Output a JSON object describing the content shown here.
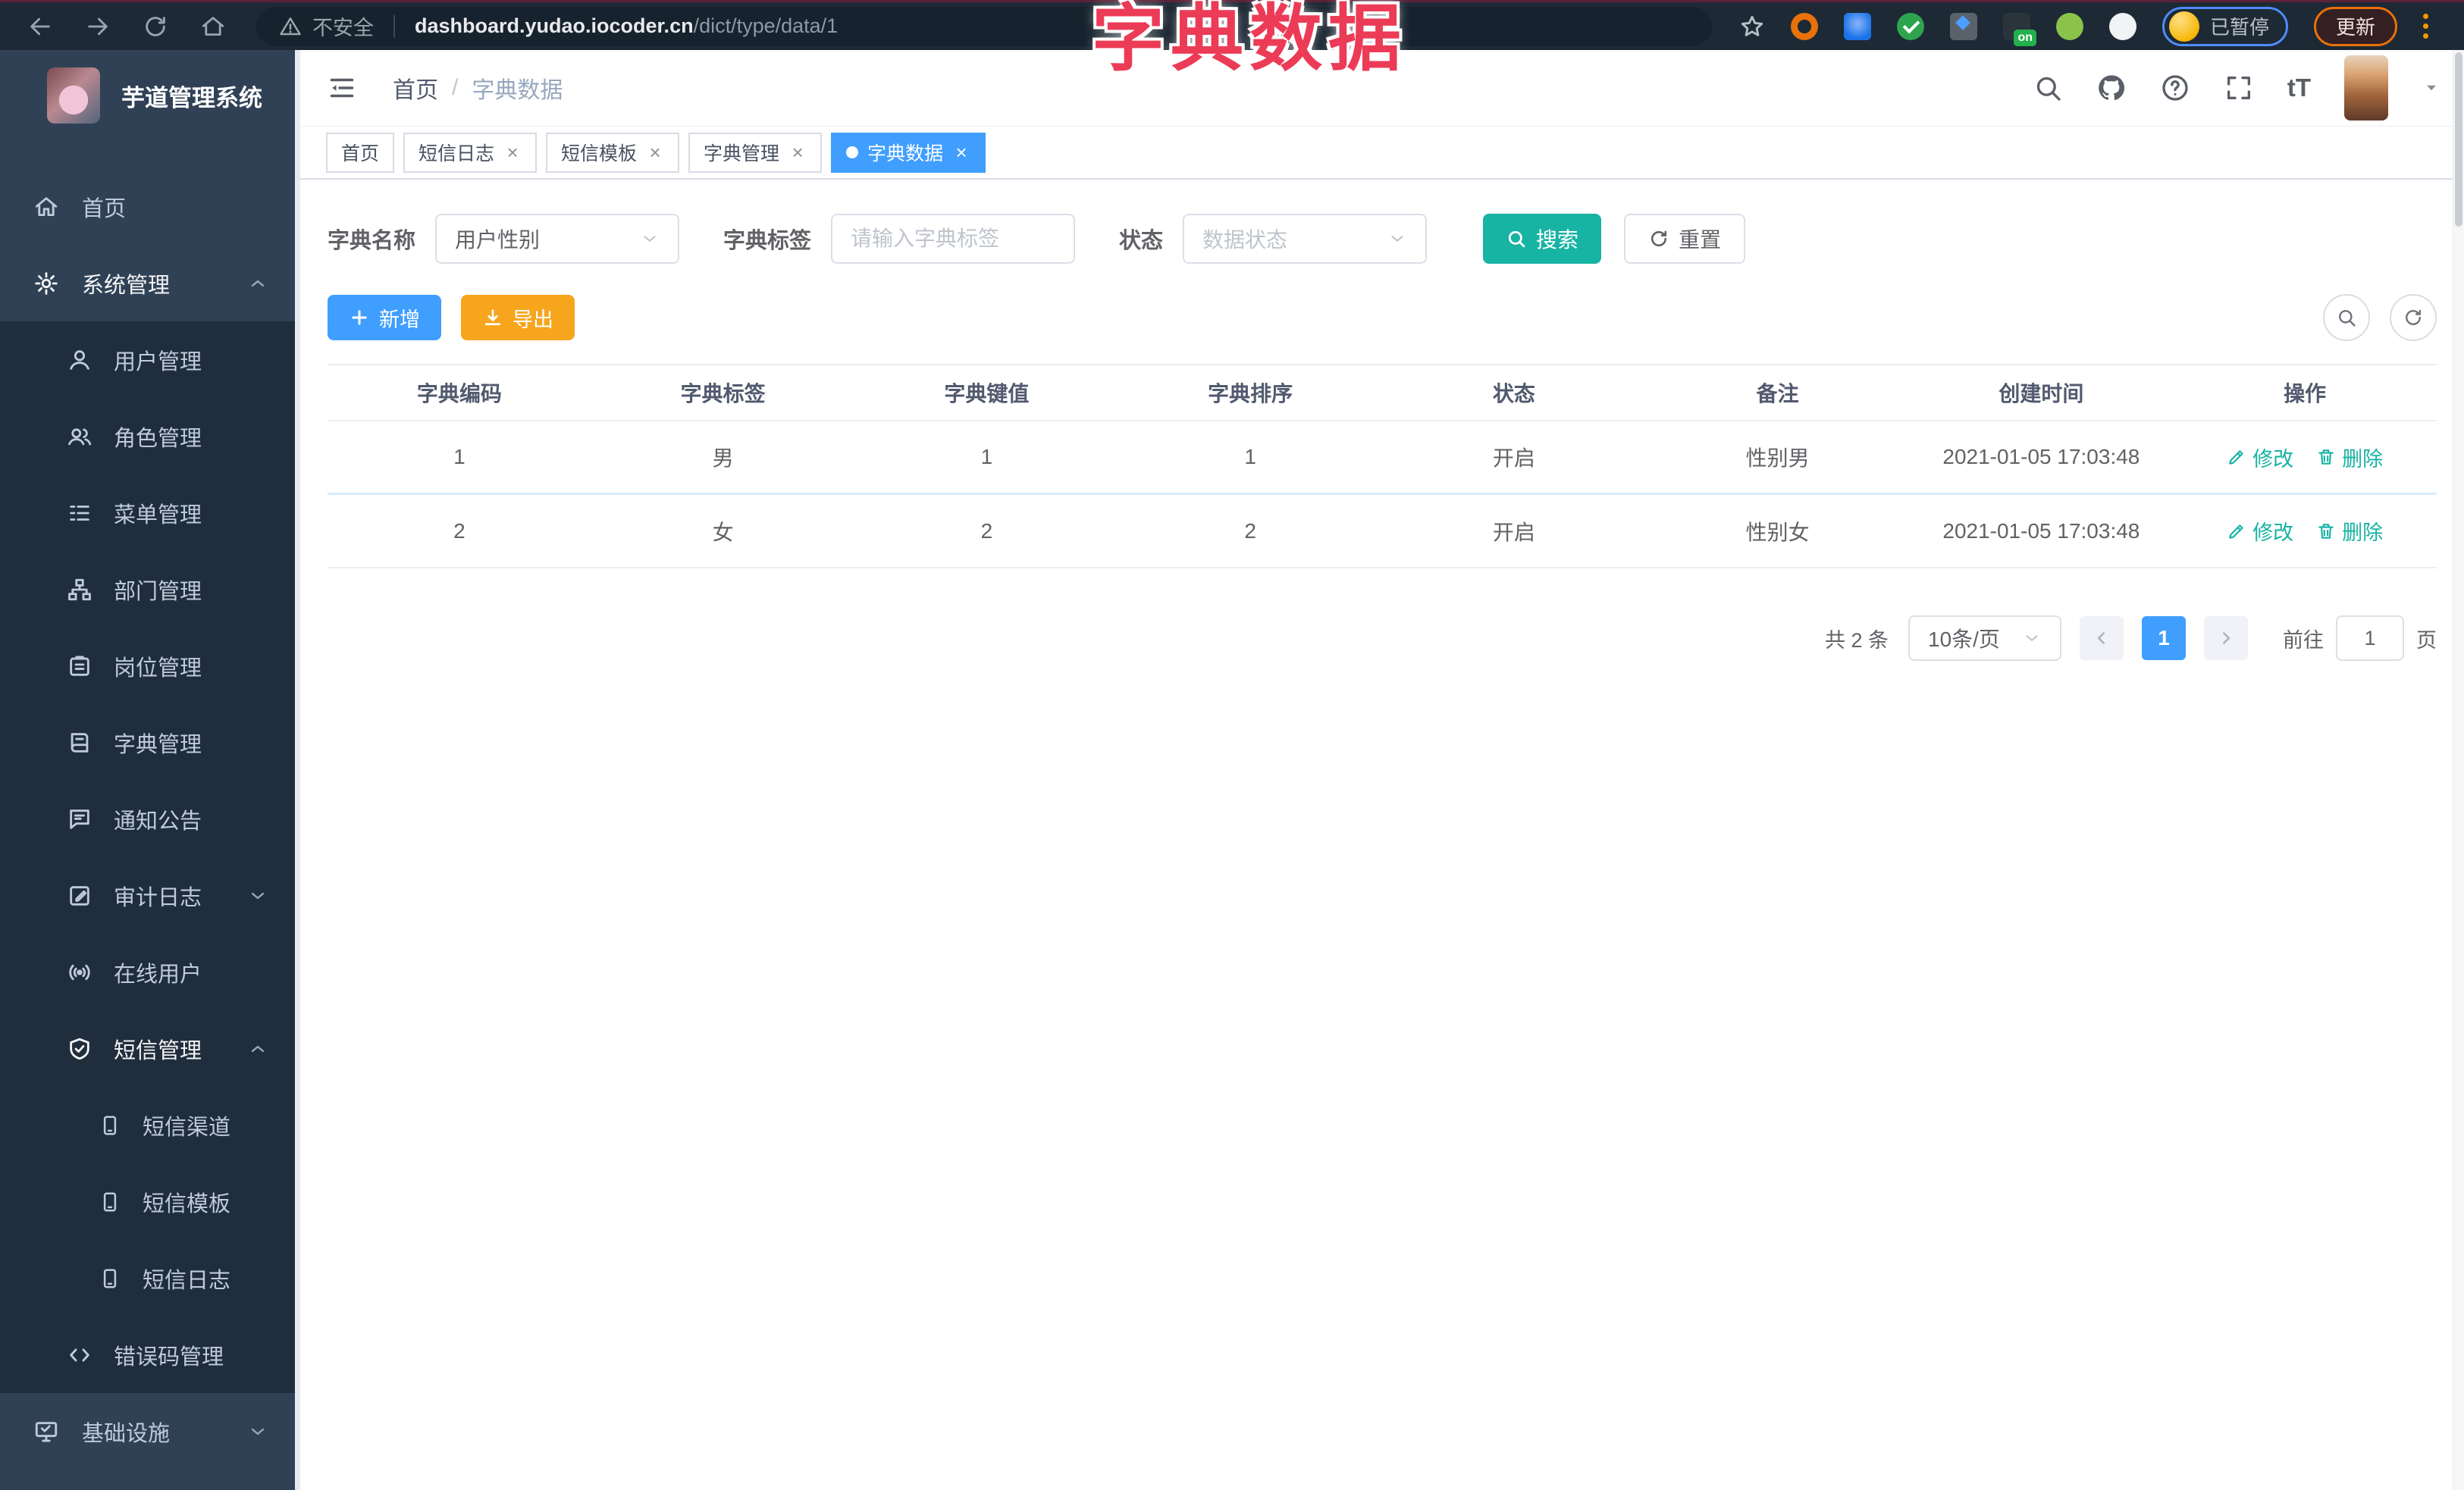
{
  "overlay_title": "字典数据",
  "browser": {
    "security_label": "不安全",
    "url_host": "dashboard.yudao.iocoder.cn",
    "url_path": "/dict/type/data/1",
    "ext_badge": "on",
    "profile_status": "已暂停",
    "update_label": "更新"
  },
  "sidebar": {
    "app_title": "芋道管理系统",
    "items": [
      {
        "label": "首页"
      },
      {
        "label": "系统管理"
      },
      {
        "label": "用户管理"
      },
      {
        "label": "角色管理"
      },
      {
        "label": "菜单管理"
      },
      {
        "label": "部门管理"
      },
      {
        "label": "岗位管理"
      },
      {
        "label": "字典管理"
      },
      {
        "label": "通知公告"
      },
      {
        "label": "审计日志"
      },
      {
        "label": "在线用户"
      },
      {
        "label": "短信管理"
      },
      {
        "label": "短信渠道"
      },
      {
        "label": "短信模板"
      },
      {
        "label": "短信日志"
      },
      {
        "label": "错误码管理"
      },
      {
        "label": "基础设施"
      }
    ]
  },
  "header": {
    "breadcrumb_home": "首页",
    "breadcrumb_sep": "/",
    "breadcrumb_current": "字典数据",
    "font_size_icon_label": "tT"
  },
  "tabs": [
    {
      "label": "首页"
    },
    {
      "label": "短信日志"
    },
    {
      "label": "短信模板"
    },
    {
      "label": "字典管理"
    },
    {
      "label": "字典数据"
    }
  ],
  "filters": {
    "dict_name_label": "字典名称",
    "dict_name_value": "用户性别",
    "dict_label_label": "字典标签",
    "dict_label_placeholder": "请输入字典标签",
    "status_label": "状态",
    "status_placeholder": "数据状态",
    "search_label": "搜索",
    "reset_label": "重置"
  },
  "toolbar": {
    "add_label": "新增",
    "export_label": "导出"
  },
  "table": {
    "columns": [
      "字典编码",
      "字典标签",
      "字典键值",
      "字典排序",
      "状态",
      "备注",
      "创建时间",
      "操作"
    ],
    "rows": [
      {
        "code": "1",
        "label": "男",
        "value": "1",
        "sort": "1",
        "status": "开启",
        "remark": "性别男",
        "created": "2021-01-05 17:03:48"
      },
      {
        "code": "2",
        "label": "女",
        "value": "2",
        "sort": "2",
        "status": "开启",
        "remark": "性别女",
        "created": "2021-01-05 17:03:48"
      }
    ],
    "edit_label": "修改",
    "delete_label": "删除"
  },
  "pagination": {
    "total_text": "共 2 条",
    "page_size": "10条/页",
    "current_page": "1",
    "goto_label": "前往",
    "goto_value": "1",
    "page_unit": "页"
  },
  "colors": {
    "primary_blue": "#409EFF",
    "teal_accent": "#17B3A3",
    "warning_orange": "#F6A51C",
    "sidebar_bg": "#304156",
    "submenu_bg": "#1F2D3D",
    "overlay_pink": "#EC3B56",
    "browser_bar_bg": "#1D2935"
  }
}
